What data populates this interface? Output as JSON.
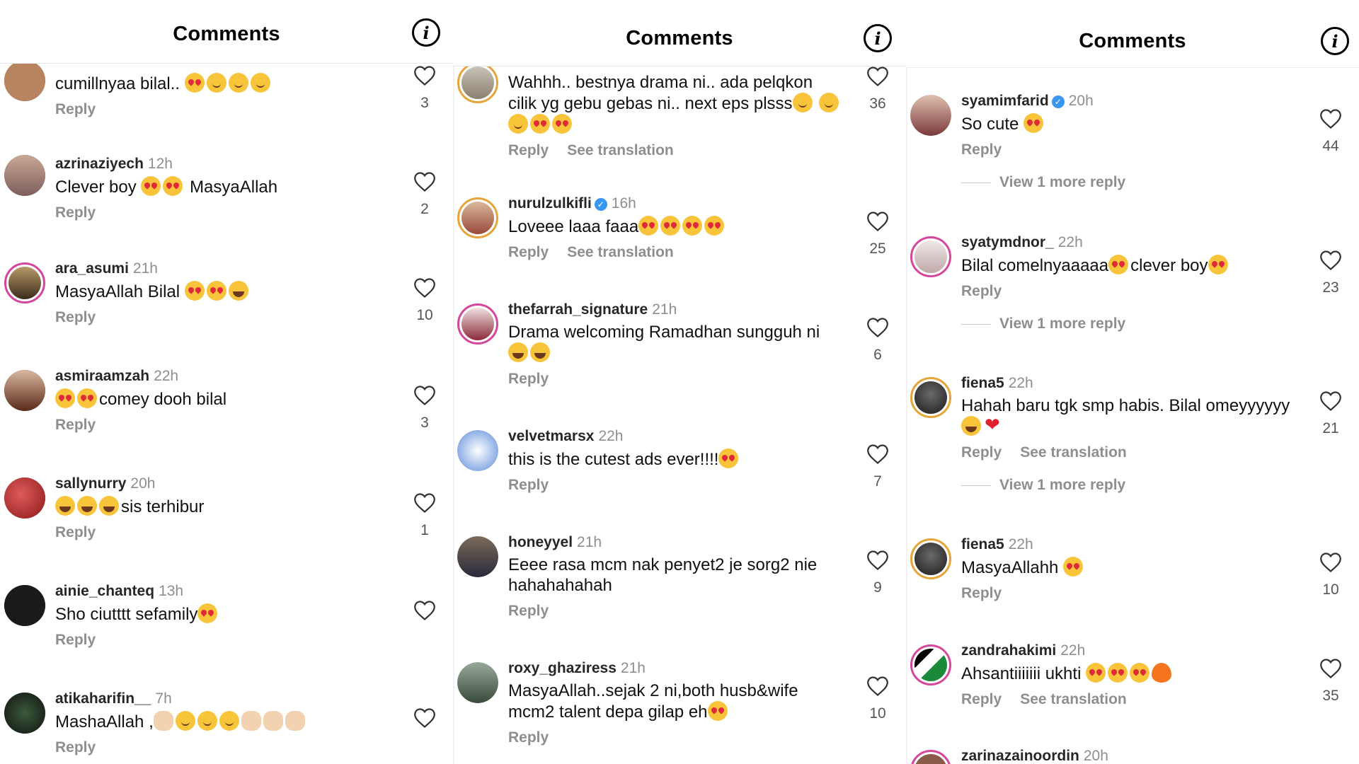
{
  "panels": [
    {
      "title": "Comments",
      "comments": [
        {
          "user": "",
          "time": "",
          "text": "cumillnyaa bilal..",
          "emoji": [
            "heart",
            "blush",
            "blush",
            "blush"
          ],
          "reply": "Reply",
          "likes": "3"
        },
        {
          "user": "azrinaziyech",
          "time": "12h",
          "text": "Clever boy",
          "emoji": [
            "heart",
            "heart"
          ],
          "text2": "MasyaAllah",
          "reply": "Reply",
          "likes": "2"
        },
        {
          "user": "ara_asumi",
          "time": "21h",
          "text": "MasyaAllah Bilal",
          "emoji": [
            "heart",
            "heart",
            "laugh"
          ],
          "reply": "Reply",
          "likes": "10"
        },
        {
          "user": "asmiraamzah",
          "time": "22h",
          "pre_emoji": [
            "heart",
            "heart"
          ],
          "text": "comey dooh bilal",
          "reply": "Reply",
          "likes": "3"
        },
        {
          "user": "sallynurry",
          "time": "20h",
          "pre_emoji": [
            "laugh",
            "laugh",
            "laugh"
          ],
          "text": "sis terhibur",
          "reply": "Reply",
          "likes": "1"
        },
        {
          "user": "ainie_chanteq",
          "time": "13h",
          "text": "Sho ciutttt sefamily",
          "emoji": [
            "heart"
          ],
          "reply": "Reply",
          "likes": ""
        },
        {
          "user": "atikaharifin__",
          "time": "7h",
          "text": "MashaAllah ,",
          "emoji": [
            "hand",
            "blush",
            "blush",
            "blush",
            "hand",
            "hand",
            "hand"
          ],
          "reply": "Reply",
          "likes": ""
        }
      ]
    },
    {
      "title": "Comments",
      "comments": [
        {
          "user": "",
          "time": "",
          "text": "Wahhh.. bestnya drama ni.. ada pelqkon cilik yg gebu gebas ni.. next eps plsss",
          "emoji": [
            "blush",
            "blush",
            "blush",
            "heart",
            "heart"
          ],
          "reply": "Reply",
          "translate": "See translation",
          "likes": "36"
        },
        {
          "user": "nurulzulkifli",
          "verified": true,
          "time": "16h",
          "text": "Loveee laaa faaa",
          "emoji": [
            "heart",
            "heart",
            "heart",
            "heart"
          ],
          "reply": "Reply",
          "translate": "See translation",
          "likes": "25"
        },
        {
          "user": "thefarrah_signature",
          "time": "21h",
          "text": "Drama welcoming Ramadhan sungguh ni",
          "emoji": [
            "laugh",
            "laugh"
          ],
          "reply": "Reply",
          "likes": "6"
        },
        {
          "user": "velvetmarsx",
          "time": "22h",
          "text": "this is the cutest ads ever!!!!",
          "emoji": [
            "heart"
          ],
          "reply": "Reply",
          "likes": "7"
        },
        {
          "user": "honeyyel",
          "time": "21h",
          "text": "Eeee rasa mcm nak penyet2 je sorg2 nie hahahahahah",
          "reply": "Reply",
          "likes": "9"
        },
        {
          "user": "roxy_ghaziress",
          "time": "21h",
          "text": "MasyaAllah..sejak 2 ni,both husb&wife mcm2 talent depa gilap eh",
          "emoji": [
            "heart"
          ],
          "reply": "Reply",
          "likes": "10"
        }
      ]
    },
    {
      "title": "Comments",
      "comments": [
        {
          "user": "syamimfarid",
          "verified": true,
          "time": "20h",
          "text": "So cute",
          "emoji": [
            "heart"
          ],
          "reply": "Reply",
          "more": "View 1 more reply",
          "likes": "44"
        },
        {
          "user": "syatymdnor_",
          "time": "22h",
          "text": "Bilal comelnyaaaaa",
          "emoji": [
            "heart"
          ],
          "text2": "clever boy",
          "emoji2": [
            "heart"
          ],
          "reply": "Reply",
          "more": "View 1 more reply",
          "likes": "23"
        },
        {
          "user": "fiena5",
          "time": "22h",
          "text": "Hahah baru tgk smp habis. Bilal omeyyyyyy",
          "emoji": [
            "laugh",
            "redheart"
          ],
          "reply": "Reply",
          "translate": "See translation",
          "more": "View 1 more reply",
          "likes": "21"
        },
        {
          "user": "fiena5",
          "time": "22h",
          "text": "MasyaAllahh",
          "emoji": [
            "heart"
          ],
          "reply": "Reply",
          "likes": "10"
        },
        {
          "user": "zandrahakimi",
          "time": "22h",
          "text": "Ahsantiiiiiii ukhti",
          "emoji": [
            "heart",
            "heart",
            "heart",
            "fire"
          ],
          "reply": "Reply",
          "translate": "See translation",
          "likes": "35"
        },
        {
          "user": "zarinazainoordin",
          "time": "20h",
          "text": "",
          "reply": "",
          "likes": ""
        }
      ]
    }
  ]
}
